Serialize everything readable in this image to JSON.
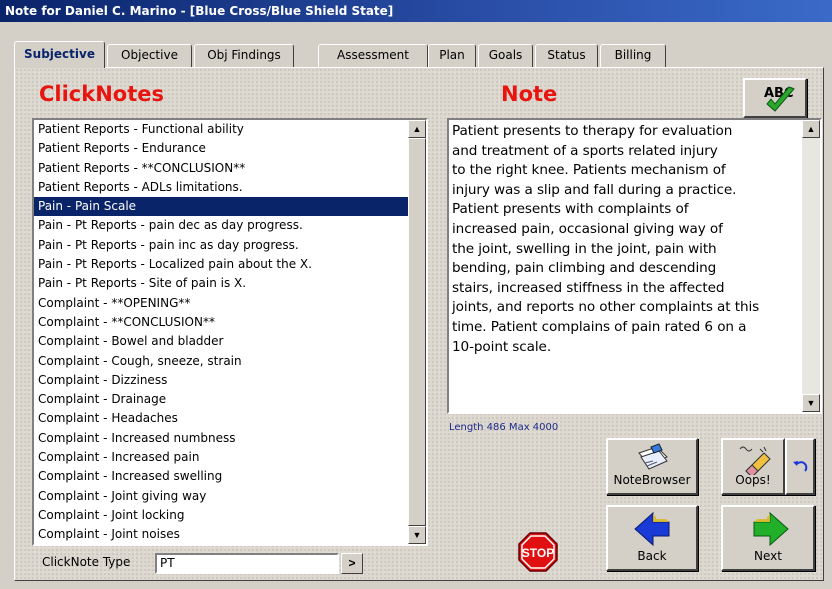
{
  "window": {
    "title": "Note for Daniel C. Marino - [Blue Cross/Blue Shield State]"
  },
  "tabs": [
    {
      "label": "Subjective",
      "active": true
    },
    {
      "label": "Objective"
    },
    {
      "label": "Obj Findings"
    },
    {
      "label": "Assessment"
    },
    {
      "label": "Plan"
    },
    {
      "label": "Goals"
    },
    {
      "label": "Status"
    },
    {
      "label": "Billing"
    }
  ],
  "clicknotes": {
    "heading": "ClickNotes",
    "items": [
      "Patient Reports - Functional ability",
      "Patient Reports - Endurance",
      "Patient Reports - **CONCLUSION**",
      "Patient Reports - ADLs limitations.",
      "Pain - Pain Scale",
      "Pain - Pt Reports - pain dec as day progress.",
      "Pain - Pt Reports - pain inc as day progress.",
      "Pain - Pt Reports - Localized pain about the X.",
      "Pain - Pt Reports - Site of pain is X.",
      "Complaint - **OPENING**",
      "Complaint - **CONCLUSION**",
      "Complaint - Bowel and bladder",
      "Complaint - Cough, sneeze, strain",
      "Complaint - Dizziness",
      "Complaint - Drainage",
      "Complaint - Headaches",
      "Complaint - Increased numbness",
      "Complaint - Increased pain",
      "Complaint - Increased swelling",
      "Complaint - Joint giving way",
      "Complaint - Joint locking",
      "Complaint - Joint noises"
    ],
    "selected_item": "Pain - Pain Scale",
    "type_label": "ClickNote Type",
    "type_value": "PT",
    "type_button": ">"
  },
  "note": {
    "heading": "Note",
    "text": "Patient presents to therapy for evaluation\nand treatment of a sports related injury\nto the right knee. Patients mechanism of\ninjury  was a slip and fall during a practice.\nPatient presents with complaints of\nincreased pain, occasional giving way of\nthe joint, swelling in the joint, pain with\nbending, pain climbing and descending\nstairs, increased stiffness in the affected\njoints, and reports no other complaints at this\ntime.  Patient complains of pain rated 6 on a\n10-point scale.",
    "length_info": "Length 486 Max 4000"
  },
  "buttons": {
    "spellcheck_icon_text": "ABC",
    "notebrowser": "NoteBrowser",
    "oops": "Oops!",
    "stop": "STOP",
    "back": "Back",
    "next": "Next"
  },
  "colors": {
    "titlebar": "#0a246a",
    "heading_red": "#e8150f",
    "selection": "#0a246a",
    "length_text": "#1c2a8a",
    "back_arrow": "#1a3ad8",
    "next_arrow": "#22b02a",
    "stop_sign": "#e01010"
  },
  "icons": {
    "spellcheck": "abc-checkmark-icon",
    "notebrowser": "note-browser-icon",
    "oops": "eraser-icon",
    "undo": "undo-arrow-icon",
    "stop": "stop-sign-icon",
    "back": "left-arrow-icon",
    "next": "right-arrow-icon"
  }
}
